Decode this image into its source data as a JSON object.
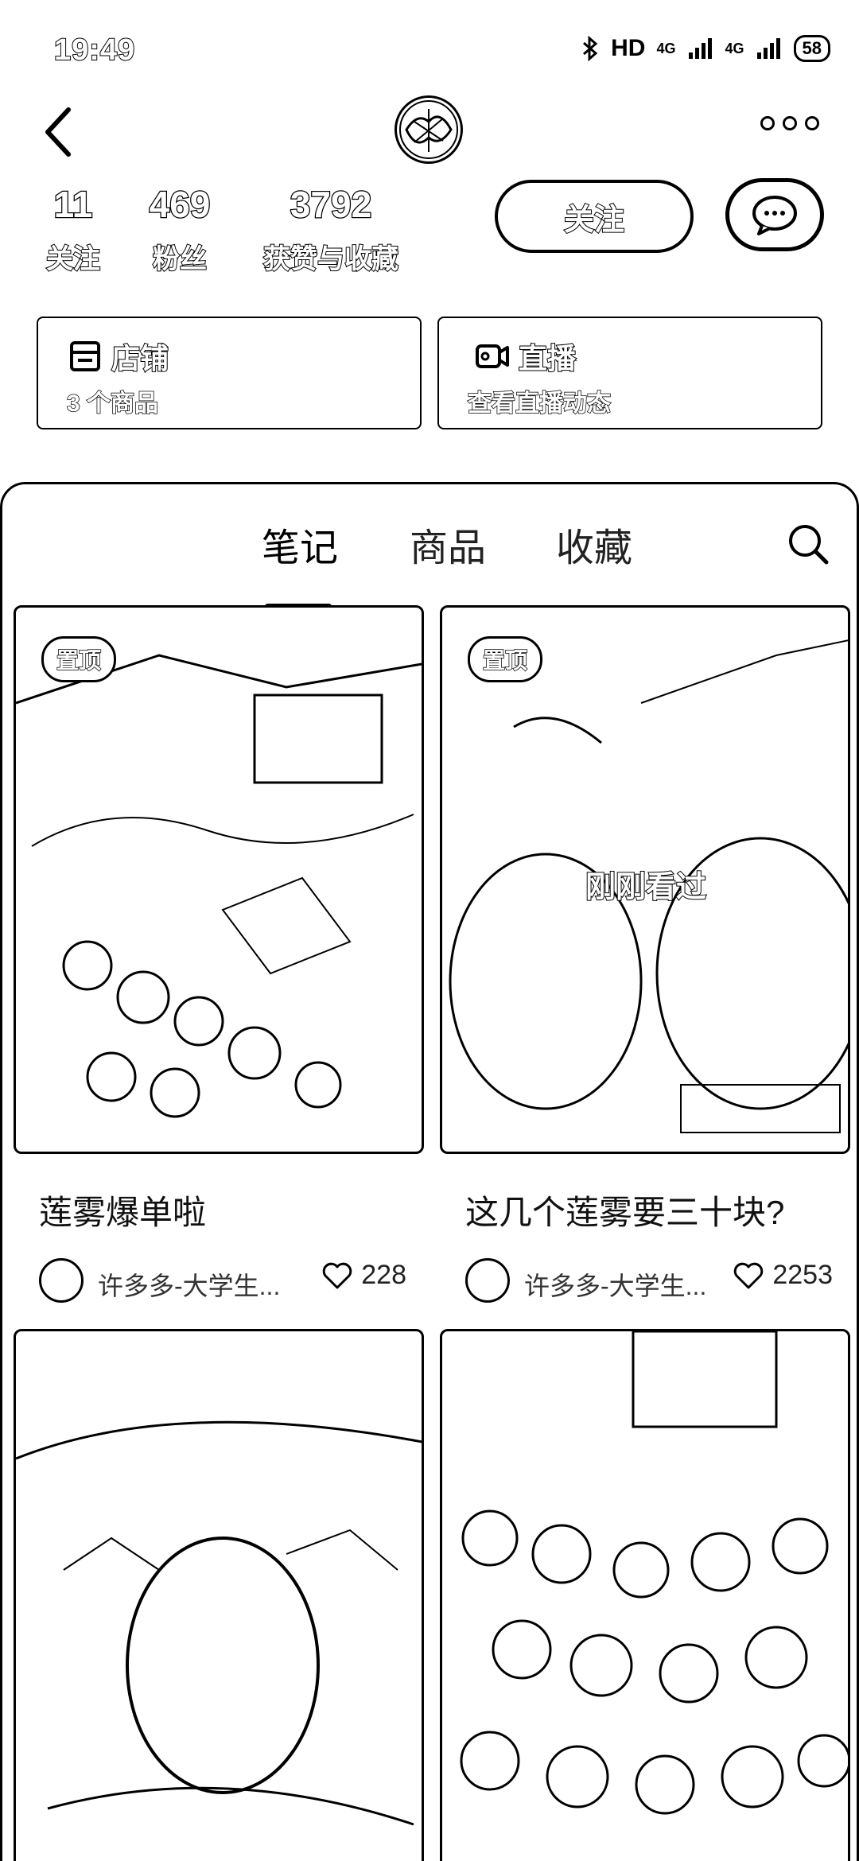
{
  "status_bar": {
    "time": "19:49",
    "bluetooth_icon": "bluetooth-icon",
    "hd_label": "HD",
    "signal_1": "4G",
    "signal_2": "4G",
    "battery": "58"
  },
  "header": {
    "back_icon": "chevron-left-icon",
    "avatar_icon": "avatar",
    "more_icon": "more-icon"
  },
  "stats": [
    {
      "value": "11",
      "label": "关注"
    },
    {
      "value": "469",
      "label": "粉丝"
    },
    {
      "value": "3792",
      "label": "获赞与收藏"
    }
  ],
  "actions": {
    "follow_label": "关注",
    "message_icon": "chat-icon"
  },
  "cards": [
    {
      "icon": "store-icon",
      "title": "店铺",
      "subtitle": "3 个商品"
    },
    {
      "icon": "live-icon",
      "title": "直播",
      "subtitle": "查看直播动态"
    }
  ],
  "tabs": [
    {
      "label": "笔记",
      "active": true
    },
    {
      "label": "商品",
      "active": false
    },
    {
      "label": "收藏",
      "active": false
    }
  ],
  "search_icon": "search-icon",
  "notes": [
    {
      "pin": "置顶",
      "seen": "",
      "caption": "莲雾爆单啦",
      "author": "许多多-大学生...",
      "likes": "228"
    },
    {
      "pin": "置顶",
      "seen": "刚刚看过",
      "caption": "这几个莲雾要三十块?",
      "author": "许多多-大学生...",
      "likes": "2253"
    },
    {
      "pin": "",
      "seen": "",
      "caption": "",
      "author": "",
      "likes": ""
    },
    {
      "pin": "",
      "seen": "",
      "caption": "",
      "author": "",
      "likes": ""
    }
  ],
  "colors": {
    "ink": "#000000",
    "paper": "#ffffff"
  }
}
